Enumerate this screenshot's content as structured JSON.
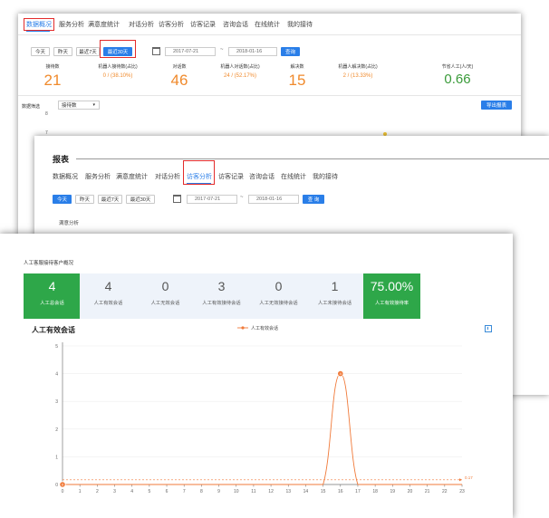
{
  "panel1": {
    "tabs": [
      "数据概况",
      "服务分析",
      "满意度统计",
      "对话分析",
      "访客分析",
      "访客记录",
      "咨询会话",
      "在线统计",
      "我的接待"
    ],
    "buttons": [
      "今天",
      "昨天",
      "最近7天",
      "最近30天"
    ],
    "date_from": "2017-07-21",
    "date_sep": "~",
    "date_to": "2018-01-16",
    "query": "查询",
    "metrics": [
      {
        "label": "接待数",
        "value": "21",
        "color": "#f08a2c"
      },
      {
        "label": "机器人接待数(占比)",
        "value": "0 / (38.10%)",
        "color": "#f08a2c"
      },
      {
        "label": "对话数",
        "value": "46",
        "color": "#f08a2c"
      },
      {
        "label": "机器人对话数(占比)",
        "value": "24 / (52.17%)",
        "color": "#f08a2c"
      },
      {
        "label": "解决数",
        "value": "15",
        "color": "#f08a2c"
      },
      {
        "label": "机器人解决数(占比)",
        "value": "2 / (13.33%)",
        "color": "#f08a2c"
      },
      {
        "label": "节省人工(人/天)",
        "value": "0.66",
        "color": "#3a9b3a"
      }
    ],
    "filter_label": "数据筛选",
    "filter_value": "接待数",
    "export": "导出报表",
    "axis": [
      "8",
      "7"
    ]
  },
  "panel2": {
    "title": "报表",
    "tabs": [
      "数据概况",
      "服务分析",
      "满意度统计",
      "对话分析",
      "访客分析",
      "访客记录",
      "咨询会话",
      "在线统计",
      "我的接待"
    ],
    "buttons": [
      "今天",
      "昨天",
      "最近7天",
      "最近30天"
    ],
    "date_from": "2017-07-21",
    "date_sep": "~",
    "date_to": "2018-01-16",
    "query": "查 询",
    "section": "满意分析"
  },
  "panel3": {
    "section_title": "人工客服接待客户概况",
    "cards": [
      {
        "value": "4",
        "label": "人工总会话",
        "highlight": true
      },
      {
        "value": "4",
        "label": "人工有效会话",
        "highlight": false
      },
      {
        "value": "0",
        "label": "人工无效会话",
        "highlight": false
      },
      {
        "value": "3",
        "label": "人工有效接待会话",
        "highlight": false
      },
      {
        "value": "0",
        "label": "人工无效接待会话",
        "highlight": false
      },
      {
        "value": "1",
        "label": "人工未接待会话",
        "highlight": false
      },
      {
        "value": "75.00%",
        "label": "人工有效接待率",
        "highlight": true
      }
    ],
    "chart_title": "人工有效会话",
    "download_icon": "download-icon"
  },
  "chart_data": {
    "type": "line",
    "title": "人工有效会话",
    "legend": "人工有效会话",
    "legend_position": "top-center",
    "x": [
      0,
      1,
      2,
      3,
      4,
      5,
      6,
      7,
      8,
      9,
      10,
      11,
      12,
      13,
      14,
      15,
      16,
      17,
      18,
      19,
      20,
      21,
      22,
      23
    ],
    "series": [
      {
        "name": "人工有效会话",
        "values": [
          0,
          0,
          0,
          0,
          0,
          0,
          0,
          0,
          0,
          0,
          0,
          0,
          0,
          0,
          0,
          0,
          4,
          0,
          0,
          0,
          0,
          0,
          0,
          0
        ],
        "color": "#f07a3a"
      }
    ],
    "markers": [
      {
        "x": 0,
        "value": "0"
      },
      {
        "x": 16,
        "value": "4"
      }
    ],
    "average_line": {
      "value": 0.17,
      "label": "0.17"
    },
    "ylim": [
      0,
      5
    ],
    "yticks": [
      "0",
      "1",
      "2",
      "3",
      "4",
      "5"
    ],
    "xlim": [
      0,
      23
    ],
    "grid": true
  }
}
